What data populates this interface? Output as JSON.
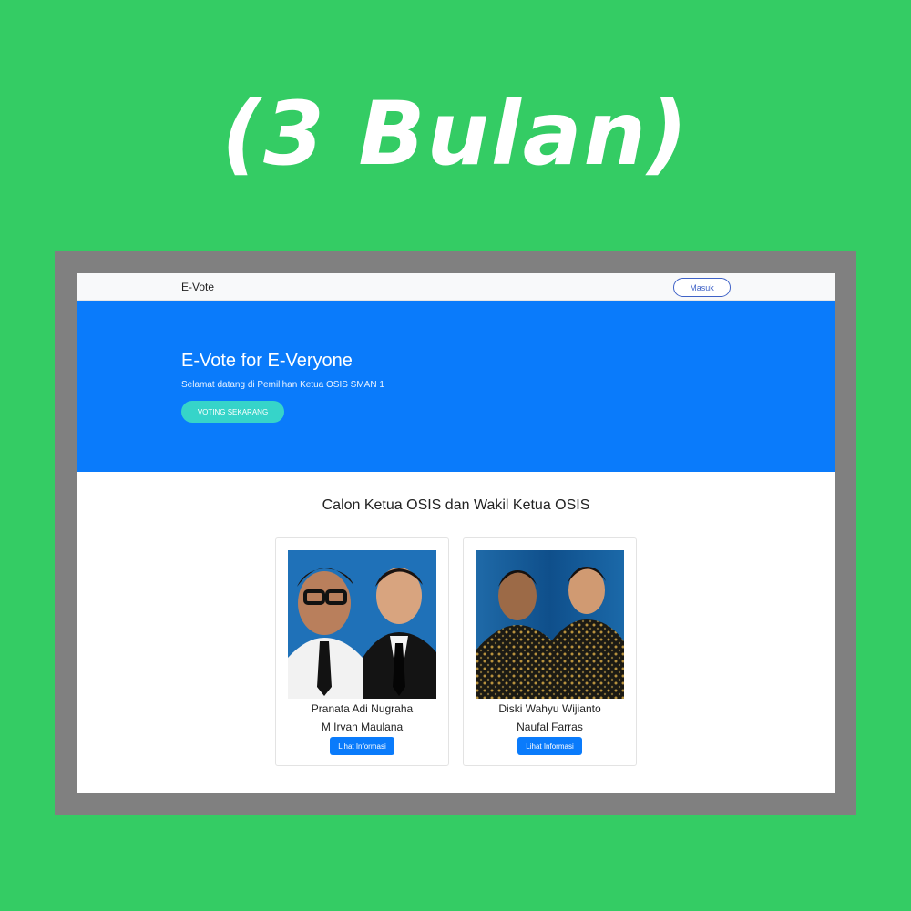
{
  "banner": {
    "headline": "(3 Bulan)"
  },
  "navbar": {
    "brand": "E-Vote",
    "login_label": "Masuk"
  },
  "hero": {
    "title": "E-Vote for E-Veryone",
    "subtitle": "Selamat datang di Pemilihan Ketua OSIS SMAN 1",
    "cta_label": "VOTING SEKARANG"
  },
  "section": {
    "title": "Calon Ketua OSIS dan Wakil Ketua OSIS"
  },
  "candidates": [
    {
      "ketua": "Pranata Adi Nugraha",
      "wakil": "M Irvan Maulana",
      "button_label": "Lihat Informasi"
    },
    {
      "ketua": "Diski Wahyu Wijianto",
      "wakil": "Naufal Farras",
      "button_label": "Lihat Informasi"
    }
  ],
  "colors": {
    "page_bg": "#34cc64",
    "hero_bg": "#0a7bfb",
    "cta_bg": "#36d4c9",
    "primary_button": "#0a7bfb"
  }
}
